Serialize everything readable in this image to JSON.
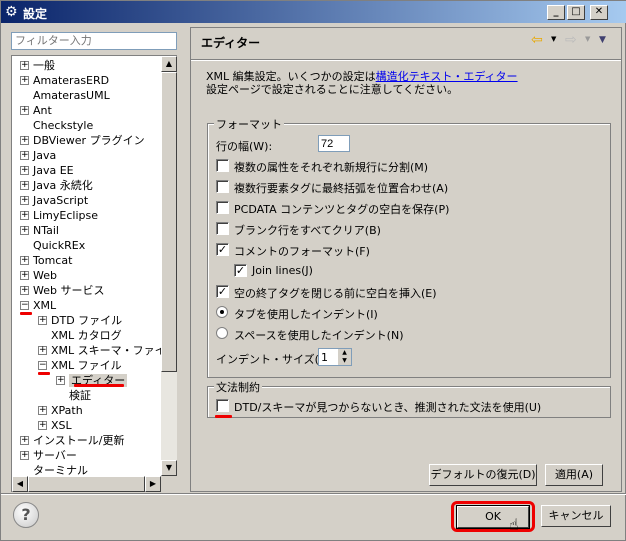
{
  "window": {
    "title": "設定",
    "title_icon": "gear-icon",
    "controls": [
      "minimize",
      "maximize",
      "close"
    ]
  },
  "filter": {
    "placeholder": "フィルター入力"
  },
  "tree": [
    {
      "label": "一般",
      "level": 0,
      "expander": "plus"
    },
    {
      "label": "AmaterasERD",
      "level": 0,
      "expander": "plus"
    },
    {
      "label": "AmaterasUML",
      "level": 0,
      "expander": "none"
    },
    {
      "label": "Ant",
      "level": 0,
      "expander": "plus"
    },
    {
      "label": "Checkstyle",
      "level": 0,
      "expander": "none"
    },
    {
      "label": "DBViewer プラグイン",
      "level": 0,
      "expander": "plus"
    },
    {
      "label": "Java",
      "level": 0,
      "expander": "plus"
    },
    {
      "label": "Java EE",
      "level": 0,
      "expander": "plus"
    },
    {
      "label": "Java 永続化",
      "level": 0,
      "expander": "plus"
    },
    {
      "label": "JavaScript",
      "level": 0,
      "expander": "plus"
    },
    {
      "label": "LimyEclipse",
      "level": 0,
      "expander": "plus"
    },
    {
      "label": "NTail",
      "level": 0,
      "expander": "plus"
    },
    {
      "label": "QuickREx",
      "level": 0,
      "expander": "none"
    },
    {
      "label": "Tomcat",
      "level": 0,
      "expander": "plus"
    },
    {
      "label": "Web",
      "level": 0,
      "expander": "plus"
    },
    {
      "label": "Web サービス",
      "level": 0,
      "expander": "plus"
    },
    {
      "label": "XML",
      "level": 0,
      "expander": "minus"
    },
    {
      "label": "DTD ファイル",
      "level": 1,
      "expander": "plus"
    },
    {
      "label": "XML カタログ",
      "level": 1,
      "expander": "none"
    },
    {
      "label": "XML スキーマ・ファイル",
      "level": 1,
      "expander": "plus"
    },
    {
      "label": "XML ファイル",
      "level": 1,
      "expander": "minus"
    },
    {
      "label": "エディター",
      "level": 2,
      "expander": "plus",
      "selected": true
    },
    {
      "label": "検証",
      "level": 2,
      "expander": "none"
    },
    {
      "label": "XPath",
      "level": 1,
      "expander": "plus"
    },
    {
      "label": "XSL",
      "level": 1,
      "expander": "plus"
    },
    {
      "label": "インストール/更新",
      "level": 0,
      "expander": "plus"
    },
    {
      "label": "サーバー",
      "level": 0,
      "expander": "plus"
    },
    {
      "label": "ターミナル",
      "level": 0,
      "expander": "none"
    }
  ],
  "page": {
    "title": "エディター",
    "desc_prefix": "XML 編集設定。いくつかの設定は",
    "desc_link": "構造化テキスト・エディター",
    "desc_line2": "設定ページで設定されることに注意してください。",
    "format_group": "フォーマット",
    "line_width_label": "行の幅(W):",
    "line_width_value": "72",
    "options": [
      {
        "label": "複数の属性をそれぞれ新規行に分割(M)",
        "checked": false,
        "type": "checkbox"
      },
      {
        "label": "複数行要素タグに最終括弧を位置合わせ(A)",
        "checked": false,
        "type": "checkbox"
      },
      {
        "label": "PCDATA コンテンツとタグの空白を保存(P)",
        "checked": false,
        "type": "checkbox"
      },
      {
        "label": "ブランク行をすべてクリア(B)",
        "checked": false,
        "type": "checkbox"
      },
      {
        "label": "コメントのフォーマット(F)",
        "checked": true,
        "type": "checkbox"
      },
      {
        "label": "Join lines(J)",
        "checked": true,
        "type": "checkbox",
        "indent": true
      },
      {
        "label": "空の終了タグを閉じる前に空白を挿入(E)",
        "checked": true,
        "type": "checkbox"
      },
      {
        "label": "タブを使用したインデント(I)",
        "checked": true,
        "type": "radio"
      },
      {
        "label": "スペースを使用したインデント(N)",
        "checked": false,
        "type": "radio"
      }
    ],
    "indent_size_label": "インデント・サイズ(D):",
    "indent_size_value": "1",
    "grammar_group": "文法制約",
    "grammar_option": "DTD/スキーマが見つからないとき、推測された文法を使用(U)",
    "grammar_checked": false,
    "restore_defaults": "デフォルトの復元(D)",
    "apply": "適用(A)"
  },
  "footer": {
    "ok": "OK",
    "cancel": "キャンセル",
    "help_icon": "help-icon"
  },
  "colors": {
    "annotation": "#e00000",
    "titlebar": "#0a246a",
    "link": "#0000ee"
  }
}
